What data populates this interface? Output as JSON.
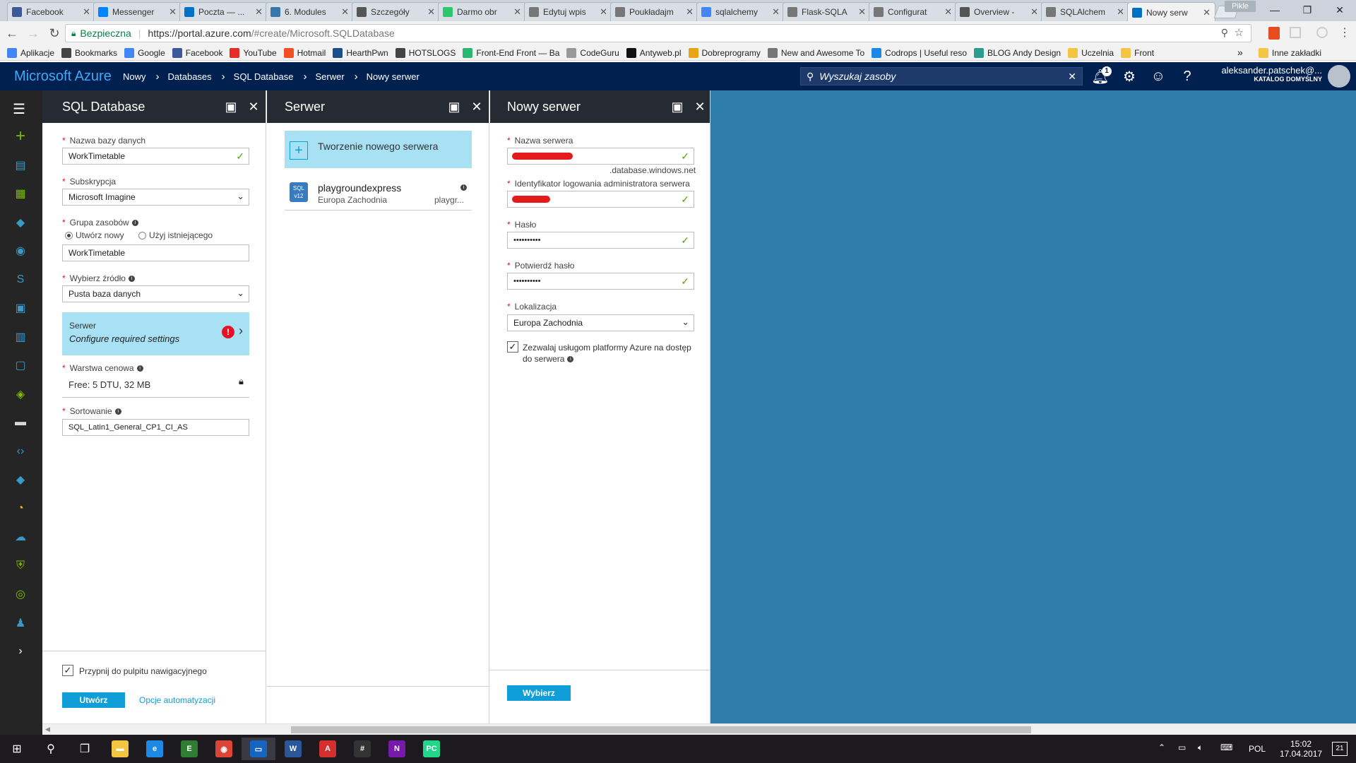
{
  "browser": {
    "tabs": [
      {
        "title": "Facebook",
        "icon": "facebook-icon",
        "color": "#3b5998"
      },
      {
        "title": "Messenger",
        "icon": "messenger-icon",
        "color": "#0084ff"
      },
      {
        "title": "Poczta — ...",
        "icon": "outlook-icon",
        "color": "#0072c6"
      },
      {
        "title": "6. Modules",
        "icon": "python-icon",
        "color": "#3776ab"
      },
      {
        "title": "Szczegóły",
        "icon": "gear-icon",
        "color": "#555555"
      },
      {
        "title": "Darmo obr",
        "icon": "pixabay-icon",
        "color": "#2ec66d"
      },
      {
        "title": "Edytuj wpis",
        "icon": "page-icon",
        "color": "#777777"
      },
      {
        "title": "Poukładajm",
        "icon": "page-icon",
        "color": "#777777"
      },
      {
        "title": "sqlalchemy",
        "icon": "google-icon",
        "color": "#4285f4"
      },
      {
        "title": "Flask-SQLA",
        "icon": "page-icon",
        "color": "#777777"
      },
      {
        "title": "Configurat",
        "icon": "page-icon",
        "color": "#777777"
      },
      {
        "title": "Overview -",
        "icon": "overview-icon",
        "color": "#555555"
      },
      {
        "title": "SQLAlchem",
        "icon": "page-icon",
        "color": "#777777"
      },
      {
        "title": "Nowy serw",
        "icon": "azure-cloud-icon",
        "color": "#0072c6"
      }
    ],
    "profile_label": "Pikle",
    "secure_label": "Bezpieczna",
    "url_base": "https://portal.azure.com",
    "url_rest": "/#create/Microsoft.SQLDatabase",
    "bookmarks": [
      {
        "label": "Aplikacje",
        "color": "#4285f4"
      },
      {
        "label": "Bookmarks",
        "color": "#444444"
      },
      {
        "label": "Google",
        "color": "#4285f4"
      },
      {
        "label": "Facebook",
        "color": "#3b5998"
      },
      {
        "label": "YouTube",
        "color": "#e52d27"
      },
      {
        "label": "Hotmail",
        "color": "#f25022"
      },
      {
        "label": "HearthPwn",
        "color": "#1b4f8a"
      },
      {
        "label": "HOTSLOGS",
        "color": "#444444"
      },
      {
        "label": "Front-End Front — Ba",
        "color": "#2bb673"
      },
      {
        "label": "CodeGuru",
        "color": "#999999"
      },
      {
        "label": "Antyweb.pl",
        "color": "#111111"
      },
      {
        "label": "Dobreprogramy",
        "color": "#e8a317"
      },
      {
        "label": "New and Awesome To",
        "color": "#777777"
      },
      {
        "label": "Codrops | Useful reso",
        "color": "#1e88e5"
      },
      {
        "label": "BLOG Andy Design",
        "color": "#2a9d8f"
      },
      {
        "label": "Uczelnia",
        "color": "#f4c542"
      },
      {
        "label": "Front",
        "color": "#f4c542"
      }
    ],
    "other_bookmarks": "Inne zakładki"
  },
  "portal": {
    "brand": "Microsoft Azure",
    "breadcrumbs": [
      "Nowy",
      "Databases",
      "SQL Database",
      "Serwer",
      "Nowy serwer"
    ],
    "search_placeholder": "Wyszukaj zasoby",
    "notification_count": "1",
    "user_name": "aleksander.patschek@...",
    "user_directory": "KATALOG DOMYŚLNY"
  },
  "sidebar": {
    "items": [
      {
        "name": "new-resource-icon",
        "color": "#7fba00",
        "glyph": "+"
      },
      {
        "name": "dashboard-icon",
        "color": "#3999c6",
        "glyph": "▤"
      },
      {
        "name": "all-resources-icon",
        "color": "#7fba00",
        "glyph": "▦"
      },
      {
        "name": "resource-groups-icon",
        "color": "#3999c6",
        "glyph": "◆"
      },
      {
        "name": "app-services-icon",
        "color": "#3999c6",
        "glyph": "◉"
      },
      {
        "name": "sql-databases-icon",
        "color": "#3999c6",
        "glyph": "S"
      },
      {
        "name": "virtual-machines-classic-icon",
        "color": "#3999c6",
        "glyph": "▣"
      },
      {
        "name": "cloud-services-icon",
        "color": "#3999c6",
        "glyph": "▥"
      },
      {
        "name": "virtual-machines-icon",
        "color": "#3999c6",
        "glyph": "▢"
      },
      {
        "name": "load-balancers-icon",
        "color": "#7fba00",
        "glyph": "◈"
      },
      {
        "name": "storage-accounts-icon",
        "color": "#d8d8d8",
        "glyph": "▬"
      },
      {
        "name": "virtual-networks-icon",
        "color": "#3999c6",
        "glyph": "‹›"
      },
      {
        "name": "active-directory-icon",
        "color": "#3999c6",
        "glyph": "◆"
      },
      {
        "name": "monitor-icon",
        "color": "#f7b500",
        "glyph": "◔"
      },
      {
        "name": "advisor-icon",
        "color": "#3999c6",
        "glyph": "☁"
      },
      {
        "name": "security-center-icon",
        "color": "#7fba00",
        "glyph": "⛨"
      },
      {
        "name": "cost-management-icon",
        "color": "#7fba00",
        "glyph": "◎"
      },
      {
        "name": "help-support-icon",
        "color": "#3999c6",
        "glyph": "♟"
      },
      {
        "name": "more-services-icon",
        "color": "#ffffff",
        "glyph": "›"
      }
    ]
  },
  "blade_sqldb": {
    "title": "SQL Database",
    "db_name_label": "Nazwa bazy danych",
    "db_name_value": "WorkTimetable",
    "subscription_label": "Subskrypcja",
    "subscription_value": "Microsoft Imagine",
    "resource_group_label": "Grupa zasobów",
    "rg_create_new": "Utwórz nowy",
    "rg_use_existing": "Użyj istniejącego",
    "rg_value": "WorkTimetable",
    "source_label": "Wybierz źródło",
    "source_value": "Pusta baza danych",
    "server_label": "Serwer",
    "server_value": "Configure required settings",
    "pricing_label": "Warstwa cenowa",
    "pricing_value": "Free: 5 DTU, 32 MB",
    "collation_label": "Sortowanie",
    "collation_value": "SQL_Latin1_General_CP1_CI_AS",
    "pin_label": "Przypnij do pulpitu nawigacyjnego",
    "create_button": "Utwórz",
    "automation_link": "Opcje automatyzacji"
  },
  "blade_server": {
    "title": "Serwer",
    "create_new": "Tworzenie nowego serwera",
    "server_name": "playgroundexpress",
    "server_location": "Europa Zachodnia",
    "server_short": "playgr...",
    "server_badge": "SQL",
    "server_badge_version": "v12"
  },
  "blade_newserver": {
    "title": "Nowy serwer",
    "server_name_label": "Nazwa serwera",
    "domain_suffix": ".database.windows.net",
    "admin_label": "Identyfikator logowania administratora serwera",
    "password_label": "Hasło",
    "password_value": "••••••••••",
    "confirm_label": "Potwierdź hasło",
    "confirm_value": "••••••••••",
    "location_label": "Lokalizacja",
    "location_value": "Europa Zachodnia",
    "allow_azure_label": "Zezwalaj usługom platformy Azure na dostęp do serwera",
    "select_button": "Wybierz"
  },
  "taskbar": {
    "apps": [
      {
        "name": "file-explorer-icon",
        "color": "#f4c542",
        "glyph": "▬"
      },
      {
        "name": "edge-icon",
        "color": "#1e88e5",
        "glyph": "e"
      },
      {
        "name": "calculator-app-icon",
        "color": "#2e7d32",
        "glyph": "E"
      },
      {
        "name": "chrome-icon",
        "color": "#db4437",
        "glyph": "◉"
      },
      {
        "name": "terminal-app-icon",
        "color": "#1565c0",
        "glyph": "▭"
      },
      {
        "name": "word-icon",
        "color": "#2b579a",
        "glyph": "W"
      },
      {
        "name": "acrobat-icon",
        "color": "#d32f2f",
        "glyph": "A"
      },
      {
        "name": "slack-icon",
        "color": "#333333",
        "glyph": "#"
      },
      {
        "name": "onenote-icon",
        "color": "#7719aa",
        "glyph": "N"
      },
      {
        "name": "pycharm-icon",
        "color": "#21d789",
        "glyph": "PC"
      }
    ],
    "language": "POL",
    "time": "15:02",
    "date": "17.04.2017",
    "notification_count": "21"
  }
}
